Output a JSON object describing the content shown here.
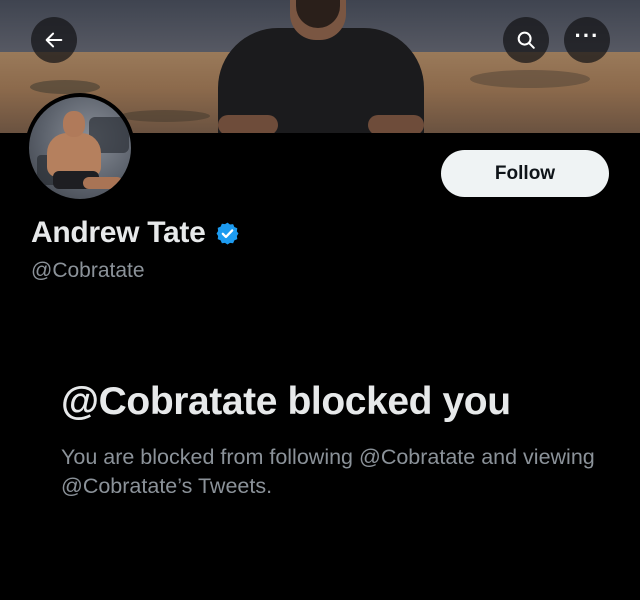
{
  "header": {
    "back_icon": "arrow-left-icon",
    "search_icon": "search-icon",
    "more_icon": "more-horizontal-icon",
    "more_glyph": "···"
  },
  "profile": {
    "display_name": "Andrew Tate",
    "verified_icon": "verified-badge-icon",
    "verified_color": "#1d9bf0",
    "handle": "@Cobratate",
    "follow_label": "Follow"
  },
  "blocked": {
    "title": "@Cobratate blocked you",
    "description": "You are blocked from following @Cobratate and viewing @Cobratate’s Tweets."
  },
  "colors": {
    "background": "#000000",
    "primary_text": "#e7e9ea",
    "secondary_text": "#8b9299",
    "follow_button_bg": "#eff3f4"
  }
}
